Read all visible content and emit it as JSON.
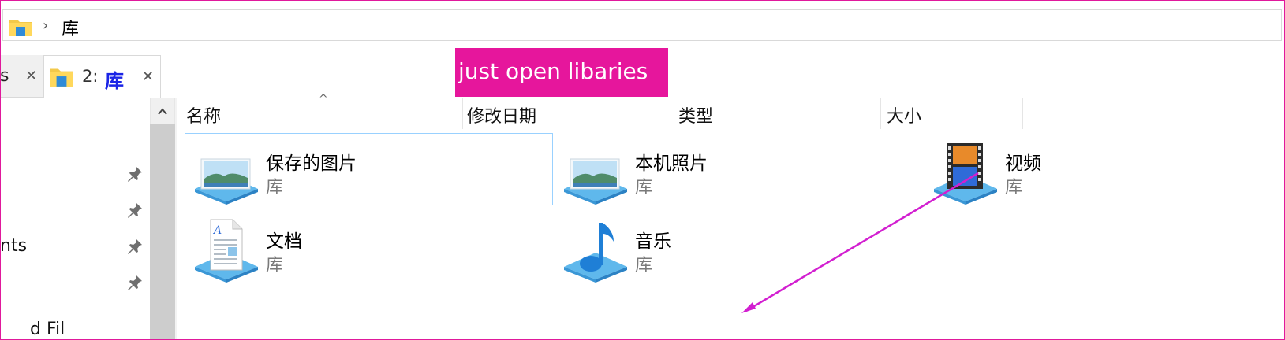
{
  "address_bar": {
    "location": "库"
  },
  "tabs": [
    {
      "label_fragment": "s",
      "close_glyph": "✕"
    },
    {
      "number": "2:",
      "title": "库",
      "close_glyph": "✕"
    }
  ],
  "annotation": {
    "text": "just open libaries",
    "color": "#e6169c"
  },
  "nav_pane": {
    "fragments": [
      "nts",
      "d Fil"
    ],
    "pins": 4
  },
  "columns": [
    {
      "label": "名称"
    },
    {
      "label": "修改日期"
    },
    {
      "label": "类型"
    },
    {
      "label": "大小"
    }
  ],
  "libraries": [
    {
      "name": "保存的图片",
      "type": "库",
      "icon": "picture-library-icon",
      "selected": true
    },
    {
      "name": "本机照片",
      "type": "库",
      "icon": "picture-library-icon",
      "selected": false
    },
    {
      "name": "视频",
      "type": "库",
      "icon": "video-library-icon",
      "selected": false
    },
    {
      "name": "文档",
      "type": "库",
      "icon": "document-library-icon",
      "selected": false
    },
    {
      "name": "音乐",
      "type": "库",
      "icon": "music-library-icon",
      "selected": false
    }
  ],
  "colors": {
    "selection_border": "#99d1ff",
    "accent_title": "#1a24e6",
    "annotation_arrow": "#d21fd0"
  }
}
